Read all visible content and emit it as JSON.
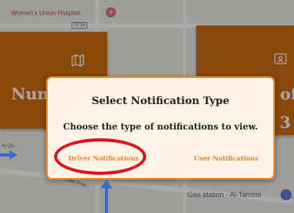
{
  "map": {
    "hospital_label": "Women's Union Hospital",
    "hospital_icon": "hospital-pin-icon",
    "route_badge": "ST15",
    "left_label": "Al-Qu...",
    "road_label": "Suleiman Frez...",
    "gas_station_label": "Gas station - Al-Tamimi",
    "gas_icon": "gas-station-pin-icon"
  },
  "cards": {
    "left": {
      "icon": "map-icon",
      "text": "Num"
    },
    "right": {
      "icon": "id-card-icon",
      "text_top": "r of",
      "text_bottom": "3"
    }
  },
  "dialog": {
    "title": "Select Notification Type",
    "message": "Choose the type of notifications to view.",
    "driver_button": "Driver Notifications",
    "user_button": "User Notifications"
  },
  "colors": {
    "card_orange": "#cc6600",
    "dialog_bg": "#fdf3e6",
    "accent": "#e8862c",
    "highlight_red": "#e0121d",
    "arrow_blue": "#3a6cc9"
  }
}
